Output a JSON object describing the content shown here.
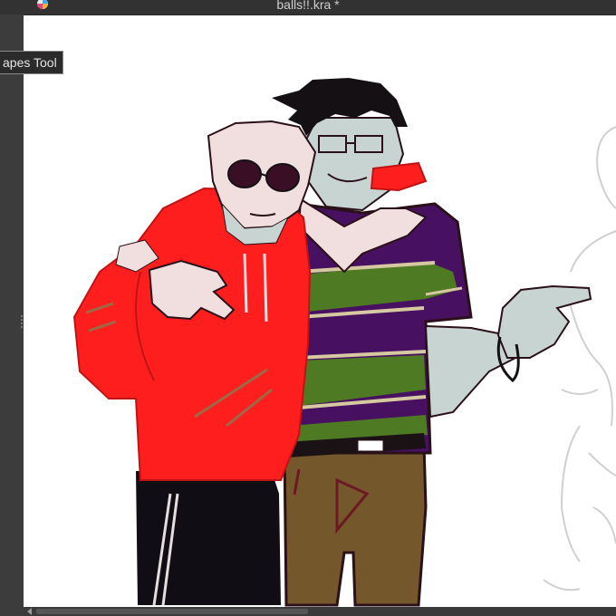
{
  "window": {
    "title": "balls!!.kra *"
  },
  "tooltip": {
    "text": "apes Tool"
  },
  "canvas": {
    "background": "#ffffff"
  },
  "artwork": {
    "colors": {
      "hoodie": "#fe1e1e",
      "hoodie_shadow": "#c01414",
      "hoodie_stripe": "#9b6a46",
      "pants_black": "#110d15",
      "pants_brown": "#74572a",
      "shirt_purple": "#471060",
      "shirt_green": "#4d7a23",
      "shirt_tan": "#d6c8a0",
      "skin_pink": "#f1dede",
      "skin_blue": "#c8d4d2",
      "hair": "#141014",
      "sunglasses": "#3a0f26",
      "outline": "#2a1018",
      "sketch_gray": "#cfcfcf"
    }
  },
  "icons": {
    "app": "krita-logo-icon",
    "scroll_left": "chevron-left-icon"
  }
}
